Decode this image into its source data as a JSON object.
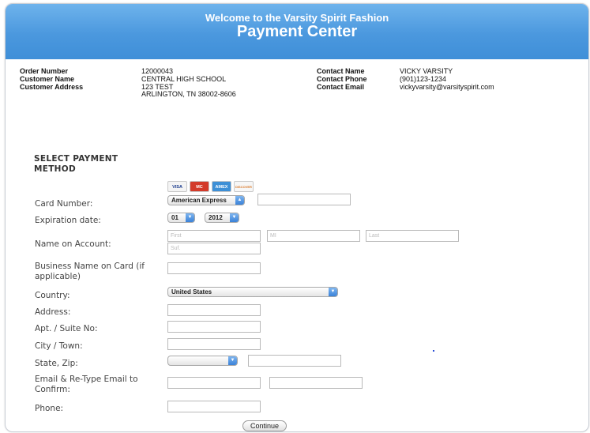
{
  "header": {
    "welcome": "Welcome to the Varsity Spirit Fashion",
    "title": "Payment Center"
  },
  "order_info": {
    "order_number_label": "Order Number",
    "order_number": "12000043",
    "customer_name_label": "Customer Name",
    "customer_name": "CENTRAL HIGH SCHOOL",
    "customer_address_label": "Customer Address",
    "address_line1": "123 TEST",
    "address_line2": "ARLINGTON, TN 38002-8606",
    "contact_name_label": "Contact Name",
    "contact_name": "VICKY VARSITY",
    "contact_phone_label": "Contact Phone",
    "contact_phone": "(901)123-1234",
    "contact_email_label": "Contact Email",
    "contact_email": "vickyvarsity@varsityspirit.com"
  },
  "payment": {
    "section_title_line1": "SELECT PAYMENT",
    "section_title_line2": "METHOD",
    "cards": [
      "VISA",
      "MC",
      "AMEX",
      "DISCOVER"
    ],
    "card_number_label": "Card Number:",
    "card_type": "American Express",
    "expiration_label": "Expiration date:",
    "exp_month": "01",
    "exp_year": "2012",
    "name_label": "Name on Account:",
    "first_placeholder": "First",
    "mi_placeholder": "MI",
    "last_placeholder": "Last",
    "suffix_placeholder": "Suf.",
    "business_label_line1": "Business Name on Card (if",
    "business_label_line2": "applicable)",
    "country_label": "Country:",
    "country": "United States",
    "address_label": "Address:",
    "apt_label": "Apt. / Suite No:",
    "city_label": "City / Town:",
    "state_zip_label": "State, Zip:",
    "email_label_line1": "Email & Re-Type Email to",
    "email_label_line2": "Confirm:",
    "phone_label": "Phone:",
    "continue": "Continue"
  },
  "colors": {
    "banner_top": "#6eb3ec",
    "banner_bottom": "#3f8fd8",
    "amex": "#3d8fd6",
    "visa": "#1a3a8c",
    "mastercard": "#d33a2a"
  }
}
